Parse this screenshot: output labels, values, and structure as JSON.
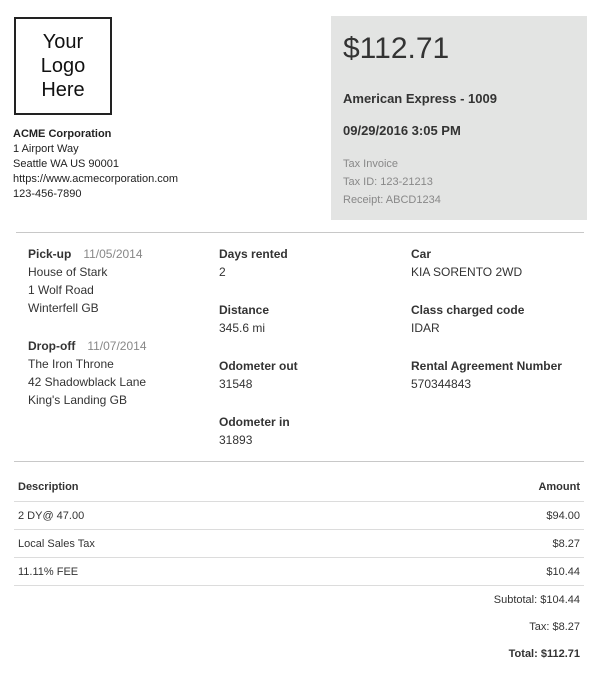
{
  "logo": {
    "text": "Your\nLogo\nHere"
  },
  "company": {
    "name": "ACME Corporation",
    "address1": "1 Airport Way",
    "address2": "Seattle WA US 90001",
    "website": "https://www.acmecorporation.com",
    "phone": "123-456-7890"
  },
  "summary": {
    "total": "$112.71",
    "card": "American Express - 1009",
    "datetime": "09/29/2016 3:05 PM",
    "doc_type": "Tax Invoice",
    "tax_id": "Tax ID: 123-21213",
    "receipt": "Receipt: ABCD1234"
  },
  "rental": {
    "pickup": {
      "label": "Pick-up",
      "date": "11/05/2014",
      "lines": [
        "House of Stark",
        "1 Wolf Road",
        "Winterfell GB"
      ]
    },
    "dropoff": {
      "label": "Drop-off",
      "date": "11/07/2014",
      "lines": [
        "The Iron Throne",
        "42 Shadowblack Lane",
        "King's Landing GB"
      ]
    },
    "days": {
      "label": "Days rented",
      "value": "2"
    },
    "distance": {
      "label": "Distance",
      "value": "345.6 mi"
    },
    "odo_out": {
      "label": "Odometer out",
      "value": "31548"
    },
    "odo_in": {
      "label": "Odometer in",
      "value": "31893"
    },
    "car": {
      "label": "Car",
      "value": "KIA SORENTO 2WD"
    },
    "class_code": {
      "label": "Class charged code",
      "value": "IDAR"
    },
    "agreement": {
      "label": "Rental Agreement Number",
      "value": "570344843"
    }
  },
  "items": {
    "headers": {
      "description": "Description",
      "amount": "Amount"
    },
    "rows": [
      {
        "description": "2 DY@ 47.00",
        "amount": "$94.00"
      },
      {
        "description": "Local Sales Tax",
        "amount": "$8.27"
      },
      {
        "description": "11.11% FEE",
        "amount": "$10.44"
      }
    ],
    "subtotal": "Subtotal: $104.44",
    "tax": "Tax: $8.27",
    "total": "Total: $112.71"
  }
}
